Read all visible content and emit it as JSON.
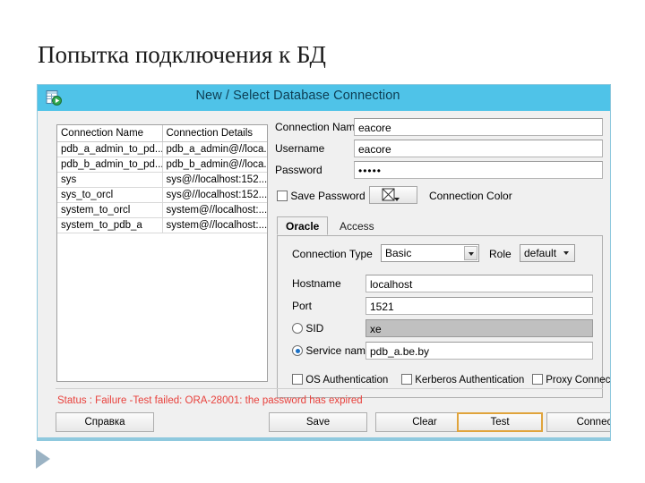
{
  "slide": {
    "title": "Попытка подключения к БД"
  },
  "dialog": {
    "title": "New / Select Database Connection",
    "icon": "database-connection-icon"
  },
  "connection_list": {
    "columns": [
      "Connection Name",
      "Connection Details"
    ],
    "rows": [
      [
        "pdb_a_admin_to_pd...",
        "pdb_a_admin@//loca..."
      ],
      [
        "pdb_b_admin_to_pd...",
        "pdb_b_admin@//loca..."
      ],
      [
        "sys",
        "sys@//localhost:152..."
      ],
      [
        "sys_to_orcl",
        "sys@//localhost:152..."
      ],
      [
        "system_to_orcl",
        "system@//localhost:..."
      ],
      [
        "system_to_pdb_a",
        "system@//localhost:..."
      ]
    ]
  },
  "form": {
    "connection_name_label": "Connection Name",
    "connection_name_value": "eacore",
    "username_label": "Username",
    "username_value": "eacore",
    "password_label": "Password",
    "password_value": "•••••",
    "save_password_label": "Save Password",
    "save_password_checked": false,
    "connection_color_label": "Connection Color",
    "connection_color_swatch": "no-color"
  },
  "tabs": [
    {
      "label": "Oracle",
      "active": true
    },
    {
      "label": "Access",
      "active": false
    }
  ],
  "oracle_panel": {
    "connection_type_label": "Connection Type",
    "connection_type_value": "Basic",
    "role_label": "Role",
    "role_value": "default",
    "hostname_label": "Hostname",
    "hostname_value": "localhost",
    "port_label": "Port",
    "port_value": "1521",
    "sid_label": "SID",
    "sid_value": "xe",
    "sid_selected": false,
    "service_name_label": "Service name",
    "service_name_value": "pdb_a.be.by",
    "service_name_selected": true,
    "checkboxes": [
      {
        "label": "OS Authentication",
        "checked": false
      },
      {
        "label": "Kerberos Authentication",
        "checked": false
      },
      {
        "label": "Proxy Connection",
        "checked": false
      }
    ]
  },
  "status": {
    "text": "Status : Failure -Test failed: ORA-28001: the password has expired",
    "color": "#e8413c"
  },
  "buttons": [
    {
      "label": "Справка",
      "focused": false
    },
    {
      "label": "Save",
      "focused": false
    },
    {
      "label": "Clear",
      "focused": false
    },
    {
      "label": "Test",
      "focused": true
    },
    {
      "label": "Connect",
      "focused": false
    }
  ]
}
